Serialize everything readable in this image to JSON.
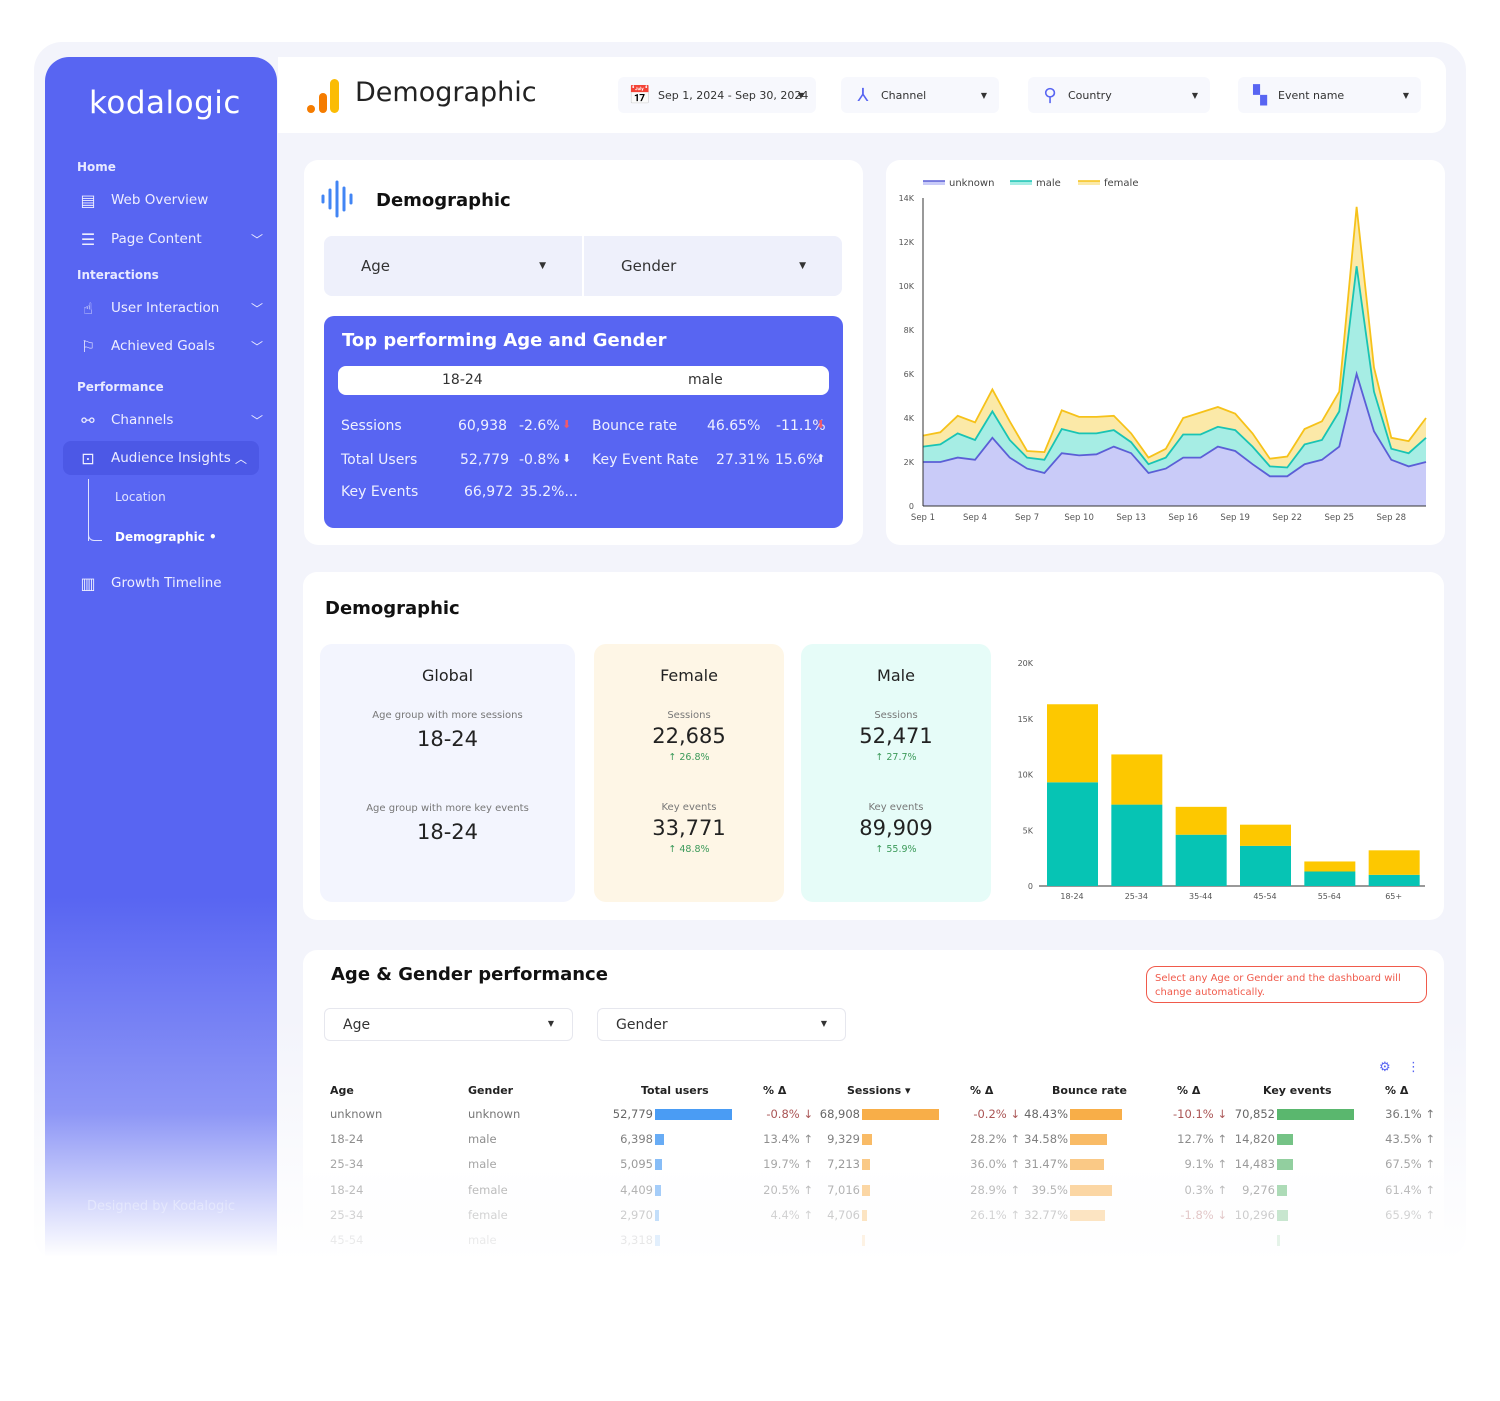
{
  "brand": "kodalogic",
  "sidebar": {
    "sections": [
      "Home",
      "Interactions",
      "Performance"
    ],
    "items": [
      {
        "label": "Web Overview",
        "icon": "browser-icon"
      },
      {
        "label": "Page Content",
        "icon": "list-icon"
      },
      {
        "label": "User Interaction",
        "icon": "hand-pointer-icon"
      },
      {
        "label": "Achieved Goals",
        "icon": "flag-icon"
      },
      {
        "label": "Channels",
        "icon": "share-icon"
      },
      {
        "label": "Audience Insights",
        "icon": "audience-icon"
      },
      {
        "label": "Growth Timeline",
        "icon": "bar-chart-icon"
      }
    ],
    "subitems": [
      "Location",
      "Demographic •"
    ],
    "credit": "Designed by Kodalogic"
  },
  "header": {
    "title": "Demographic",
    "filters": [
      {
        "label": "Sep 1, 2024 - Sep 30, 2024",
        "icon": "calendar-icon"
      },
      {
        "label": "Channel",
        "icon": "channel-icon"
      },
      {
        "label": "Country",
        "icon": "location-pin-icon"
      },
      {
        "label": "Event name",
        "icon": "shapes-icon"
      }
    ]
  },
  "colors": {
    "accent": "#5865f2",
    "unknown": "#5b5fd6",
    "male": "#19c4b4",
    "female": "#f6c21a",
    "up": "#3c9a5a",
    "down": "#f05a6b"
  },
  "demo_card": {
    "title": "Demographic",
    "age_select": "Age",
    "gender_select": "Gender",
    "top": {
      "title": "Top performing Age and Gender",
      "age": "18-24",
      "gender": "male",
      "metrics": [
        {
          "label": "Sessions",
          "value": "60,938",
          "delta": "-2.6%",
          "dir": "down"
        },
        {
          "label": "Total Users",
          "value": "52,779",
          "delta": "-0.8%",
          "dir": "down-white"
        },
        {
          "label": "Key Events",
          "value": "66,972",
          "delta": "35.2%...",
          "dir": ""
        },
        {
          "label": "Bounce rate",
          "value": "46.65%",
          "delta": "-11.1%",
          "dir": "down"
        },
        {
          "label": "Key Event Rate",
          "value": "27.31%",
          "delta": "15.6%",
          "dir": "up-white"
        }
      ]
    }
  },
  "chart_data": [
    {
      "type": "area",
      "stacked": true,
      "legend": "top-left",
      "legend_entries": [
        "unknown",
        "male",
        "female"
      ],
      "x": [
        "Sep 1",
        "Sep 2",
        "Sep 3",
        "Sep 4",
        "Sep 5",
        "Sep 6",
        "Sep 7",
        "Sep 8",
        "Sep 9",
        "Sep 10",
        "Sep 11",
        "Sep 12",
        "Sep 13",
        "Sep 14",
        "Sep 15",
        "Sep 16",
        "Sep 17",
        "Sep 18",
        "Sep 19",
        "Sep 20",
        "Sep 21",
        "Sep 22",
        "Sep 23",
        "Sep 24",
        "Sep 25",
        "Sep 26",
        "Sep 27",
        "Sep 28",
        "Sep 29",
        "Sep 30"
      ],
      "x_tick_labels": [
        "Sep 1",
        "Sep 4",
        "Sep 7",
        "Sep 10",
        "Sep 13",
        "Sep 16",
        "Sep 19",
        "Sep 22",
        "Sep 25",
        "Sep 28"
      ],
      "y_tick_labels": [
        "0",
        "2K",
        "4K",
        "6K",
        "8K",
        "10K",
        "12K",
        "14K"
      ],
      "ylim": [
        0,
        14000
      ],
      "series": [
        {
          "name": "unknown",
          "color": "#5b5fd6",
          "values": [
            2000,
            2000,
            2200,
            2100,
            3100,
            2200,
            1700,
            1500,
            2400,
            2300,
            2350,
            2700,
            2400,
            1500,
            1700,
            2200,
            2200,
            2700,
            2500,
            1900,
            1350,
            1350,
            1900,
            2100,
            2700,
            6000,
            3400,
            2100,
            1800,
            2000
          ]
        },
        {
          "name": "male",
          "color": "#19c4b4",
          "values": [
            700,
            800,
            1100,
            900,
            1200,
            800,
            500,
            600,
            1100,
            1000,
            950,
            750,
            500,
            400,
            500,
            1050,
            1050,
            900,
            950,
            800,
            450,
            400,
            900,
            900,
            1600,
            4900,
            1800,
            500,
            600,
            1100
          ]
        },
        {
          "name": "female",
          "color": "#f6c21a",
          "values": [
            500,
            550,
            800,
            800,
            1000,
            850,
            300,
            350,
            850,
            750,
            750,
            650,
            400,
            300,
            400,
            750,
            1000,
            900,
            750,
            600,
            350,
            500,
            700,
            850,
            900,
            2700,
            1100,
            500,
            550,
            900
          ]
        }
      ]
    },
    {
      "type": "bar",
      "stacked": true,
      "categories": [
        "18-24",
        "25-34",
        "35-44",
        "45-54",
        "55-64",
        "65+"
      ],
      "y_tick_labels": [
        "0",
        "5K",
        "10K",
        "15K",
        "20K"
      ],
      "ylim": [
        0,
        20000
      ],
      "series": [
        {
          "name": "male",
          "color": "#06c4b4",
          "values": [
            9300,
            7300,
            4600,
            3600,
            1300,
            1000
          ]
        },
        {
          "name": "female",
          "color": "#fdc800",
          "values": [
            7000,
            4500,
            2500,
            1900,
            900,
            2200
          ]
        }
      ]
    }
  ],
  "demographic": {
    "title": "Demographic",
    "global": {
      "title": "Global",
      "label1": "Age group with more sessions",
      "value1": "18-24",
      "label2": "Age group with more key events",
      "value2": "18-24"
    },
    "female": {
      "title": "Female",
      "label1": "Sessions",
      "value1": "22,685",
      "delta1": "↑ 26.8%",
      "label2": "Key events",
      "value2": "33,771",
      "delta2": "↑ 48.8%"
    },
    "male": {
      "title": "Male",
      "label1": "Sessions",
      "value1": "52,471",
      "delta1": "↑ 27.7%",
      "label2": "Key events",
      "value2": "89,909",
      "delta2": "↑ 55.9%"
    }
  },
  "performance": {
    "title": "Age & Gender performance",
    "note": "Select any Age or Gender and the dashboard will change automatically.",
    "age_select": "Age",
    "gender_select": "Gender",
    "columns": [
      "Age",
      "Gender",
      "Total users",
      "% Δ",
      "Sessions ▾",
      "% Δ",
      "Bounce rate",
      "% Δ",
      "Key events",
      "% Δ"
    ],
    "rows": [
      [
        "unknown",
        "unknown",
        "52,779",
        "-0.8% ↓",
        "68,908",
        "-0.2% ↓",
        "48.43%",
        "-10.1% ↓",
        "70,852",
        "36.1% ↑"
      ],
      [
        "18-24",
        "male",
        "6,398",
        "13.4% ↑",
        "9,329",
        "28.2% ↑",
        "34.58%",
        "12.7% ↑",
        "14,820",
        "43.5% ↑"
      ],
      [
        "25-34",
        "male",
        "5,095",
        "19.7% ↑",
        "7,213",
        "36.0% ↑",
        "31.47%",
        "9.1% ↑",
        "14,483",
        "67.5% ↑"
      ],
      [
        "18-24",
        "female",
        "4,409",
        "20.5% ↑",
        "7,016",
        "28.9% ↑",
        "39.5%",
        "0.3% ↑",
        "9,276",
        "61.4% ↑"
      ],
      [
        "25-34",
        "female",
        "2,970",
        "4.4% ↑",
        "4,706",
        "26.1% ↑",
        "32.77%",
        "-1.8% ↓",
        "10,296",
        "65.9% ↑"
      ],
      [
        "45-54",
        "male",
        "3,318",
        "",
        "",
        "",
        "",
        "",
        "",
        ""
      ]
    ]
  }
}
